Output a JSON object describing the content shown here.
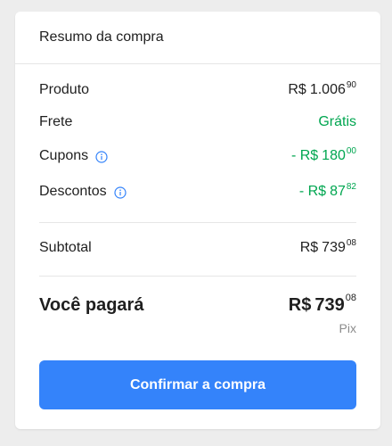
{
  "summary": {
    "title": "Resumo da compra",
    "rows": {
      "produto": {
        "label": "Produto",
        "currency": "R$",
        "integer": "1.006",
        "cents": "90"
      },
      "frete": {
        "label": "Frete",
        "value": "Grátis"
      },
      "cupons": {
        "label": "Cupons",
        "prefix": "- R$",
        "integer": "180",
        "cents": "00"
      },
      "descontos": {
        "label": "Descontos",
        "prefix": "- R$",
        "integer": "87",
        "cents": "82"
      },
      "subtotal": {
        "label": "Subtotal",
        "currency": "R$",
        "integer": "739",
        "cents": "08"
      }
    },
    "total": {
      "label": "Você pagará",
      "currency": "R$",
      "integer": "739",
      "cents": "08",
      "method": "Pix"
    },
    "confirm_label": "Confirmar a compra"
  },
  "colors": {
    "accent": "#3483fa",
    "discount_green": "#00a650",
    "text": "#1f1f1f",
    "muted": "#8c8c8c",
    "background": "#ededed"
  },
  "icons": {
    "info": "info-icon"
  }
}
